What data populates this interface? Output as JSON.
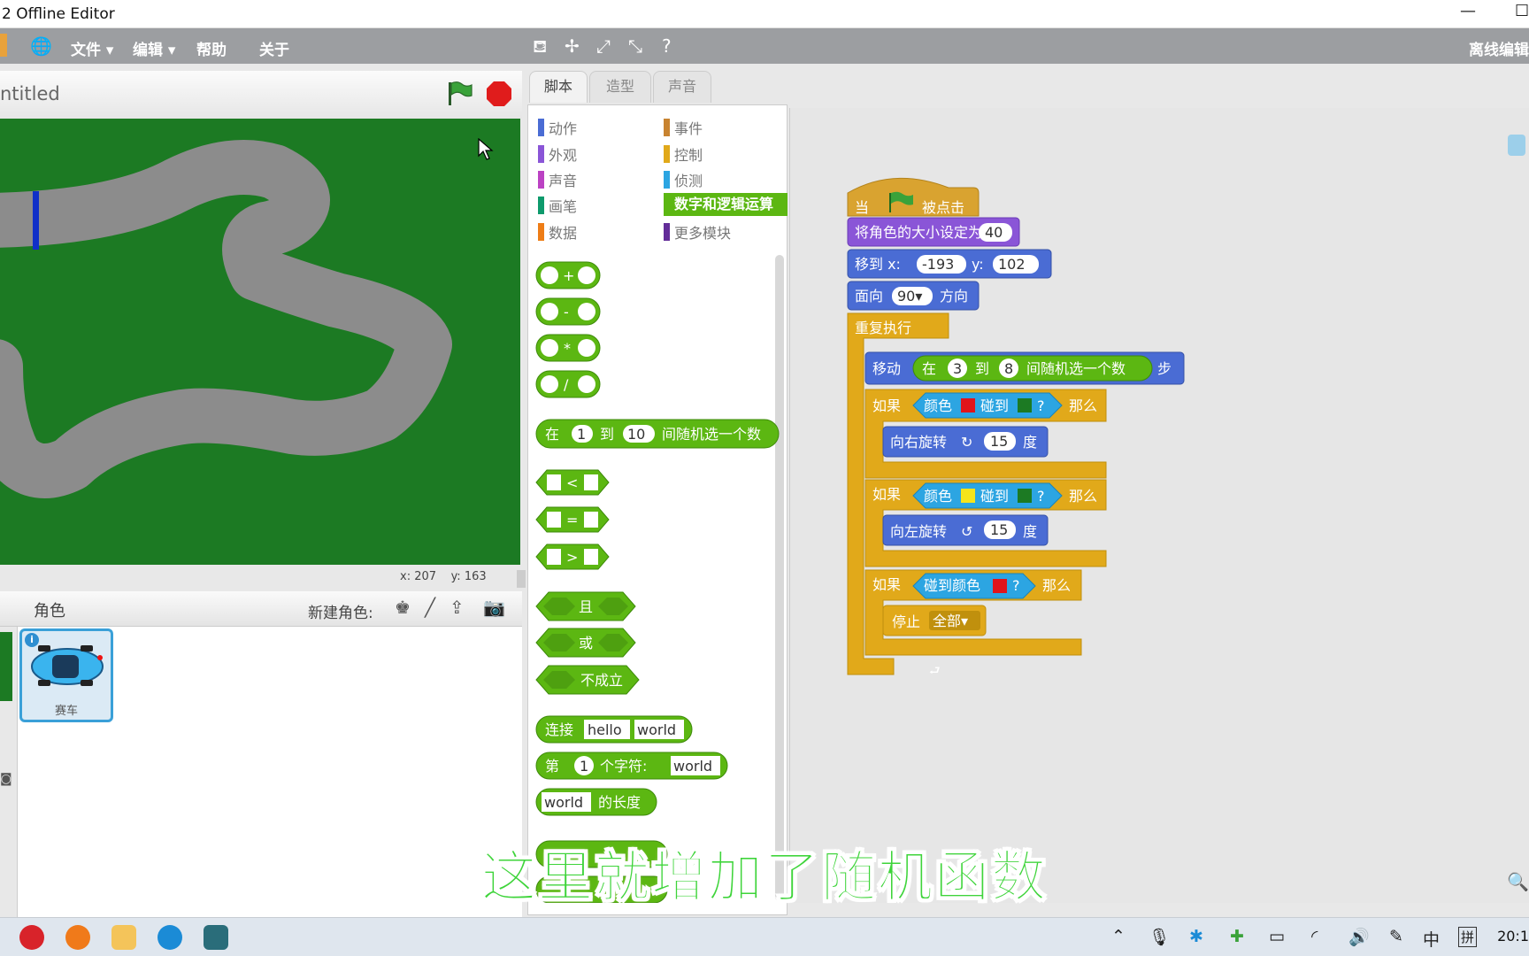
{
  "window": {
    "title": "2 Offline Editor",
    "minimize": "—",
    "maximize": "☐"
  },
  "menu": {
    "file": "文件 ▾",
    "edit": "编辑 ▾",
    "help": "帮助",
    "about": "关于",
    "mode": "离线编辑"
  },
  "stage": {
    "project_title": "ntitled",
    "mouse_x": "x: 207",
    "mouse_y": "y: 163"
  },
  "sprites": {
    "header": "角色",
    "new_sprite": "新建角色:",
    "sprite_name": "赛车"
  },
  "tabs": [
    "脚本",
    "造型",
    "声音"
  ],
  "categories": {
    "left": [
      "动作",
      "外观",
      "声音",
      "画笔",
      "数据"
    ],
    "right": [
      "事件",
      "控制",
      "侦测",
      "数字和逻辑运算",
      "更多模块"
    ],
    "left_colors": [
      "#4a6cd4",
      "#8a55d7",
      "#bb42c3",
      "#0e9a6c",
      "#ee7d16"
    ],
    "right_colors": [
      "#c88330",
      "#e1a91a",
      "#2ca5e2",
      "#5cb712",
      "#632d99"
    ]
  },
  "palette": {
    "ops": [
      "+",
      "-",
      "*",
      "/"
    ],
    "random": {
      "pre": "在",
      "from": "1",
      "to_word": "到",
      "to": "10",
      "post": "间随机选一个数"
    },
    "compare": [
      "<",
      "=",
      ">"
    ],
    "logic": [
      "且",
      "或",
      "不成立"
    ],
    "join": {
      "label": "连接",
      "a": "hello",
      "b": "world"
    },
    "letter": {
      "pre": "第",
      "n": "1",
      "mid": "个字符:",
      "s": "world"
    },
    "length": {
      "s": "world",
      "post": "的长度"
    }
  },
  "script": {
    "hat": {
      "pre": "当",
      "post": "被点击"
    },
    "size": {
      "label": "将角色的大小设定为",
      "value": "40"
    },
    "goto": {
      "label": "移到 x:",
      "x": "-193",
      "ylabel": "y:",
      "y": "102"
    },
    "point": {
      "label": "面向",
      "value": "90▾",
      "post": "方向"
    },
    "forever": "重复执行",
    "move": {
      "label": "移动",
      "pre": "在",
      "a": "3",
      "to": "到",
      "b": "8",
      "post": "间随机选一个数",
      "unit": "步"
    },
    "if1": {
      "if": "如果",
      "cond_pre": "颜色",
      "touch": "碰到",
      "q": "?",
      "then": "那么",
      "c1": "#e0141b",
      "c2": "#1c7a23"
    },
    "turn_right": {
      "label": "向右旋转",
      "sym": "↻",
      "value": "15",
      "unit": "度"
    },
    "if2": {
      "if": "如果",
      "cond_pre": "颜色",
      "touch": "碰到",
      "q": "?",
      "then": "那么",
      "c1": "#f5e41b",
      "c2": "#1c7a23"
    },
    "turn_left": {
      "label": "向左旋转",
      "sym": "↺",
      "value": "15",
      "unit": "度"
    },
    "if3": {
      "if": "如果",
      "cond": "碰到颜色",
      "q": "?",
      "then": "那么",
      "c1": "#e0141b"
    },
    "stop": {
      "label": "停止",
      "value": "全部▾"
    }
  },
  "subtitle": "这里就增加了随机函数",
  "taskbar": {
    "ime_mode": "中",
    "ime_pinyin": "拼",
    "clock": "20:1"
  }
}
